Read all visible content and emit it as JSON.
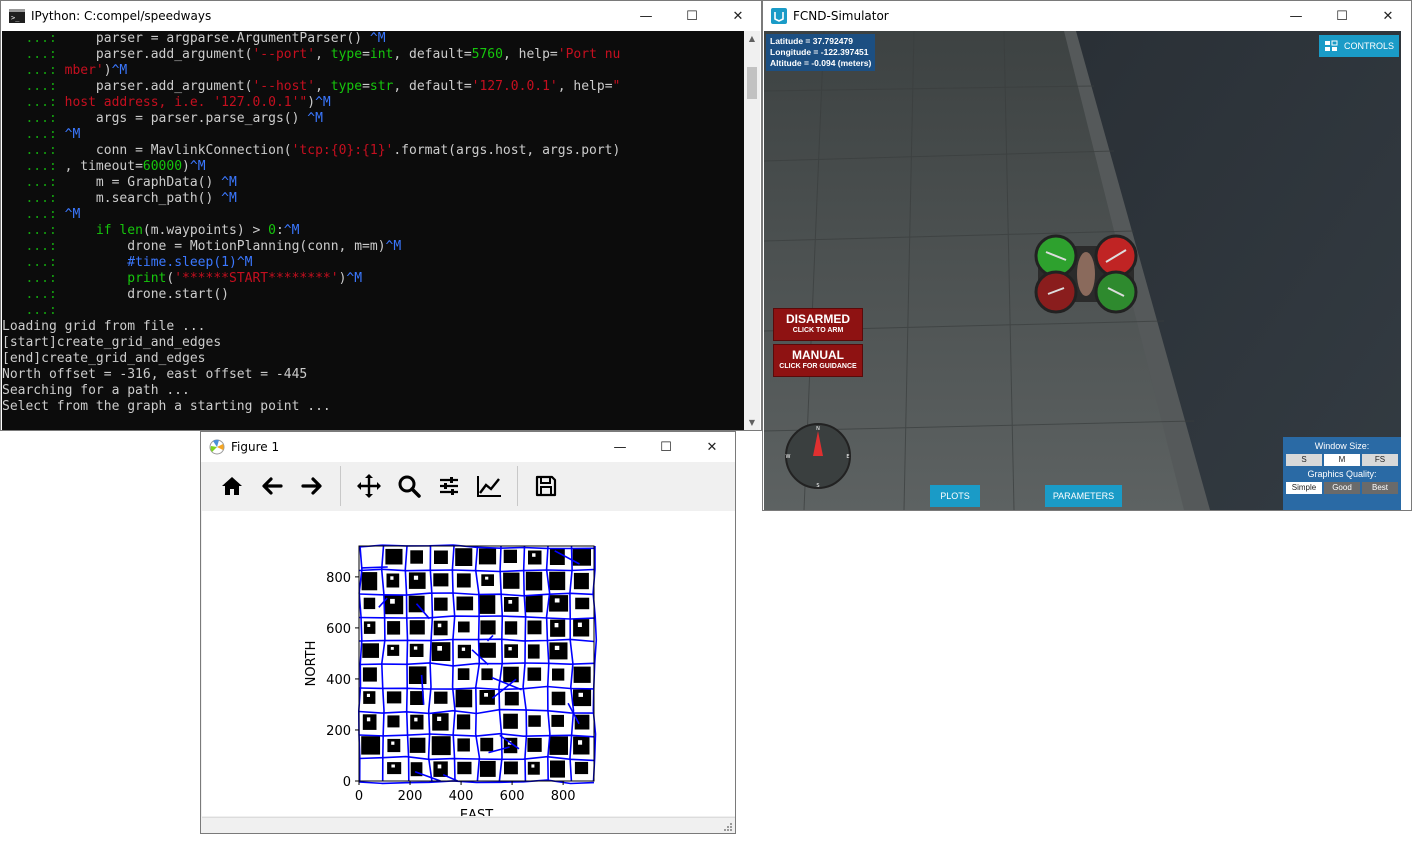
{
  "ipython": {
    "title": "IPython: C:compel/speedways",
    "lines": [
      [
        [
          "prm",
          "   ...: "
        ],
        [
          "cw",
          "    parser = argparse.ArgumentParser() "
        ],
        [
          "cb",
          "^M"
        ]
      ],
      [
        [
          "prm",
          "   ...: "
        ],
        [
          "cw",
          "    parser.add_argument("
        ],
        [
          "cr",
          "'--port'"
        ],
        [
          "cw",
          ", "
        ],
        [
          "cg",
          "type"
        ],
        [
          "cw",
          "="
        ],
        [
          "cg",
          "int"
        ],
        [
          "cw",
          ", default="
        ],
        [
          "cg",
          "5760"
        ],
        [
          "cw",
          ", help="
        ],
        [
          "cr",
          "'Port nu"
        ]
      ],
      [
        [
          "prm",
          "   ...: "
        ],
        [
          "cr",
          "mber'"
        ],
        [
          "cw",
          ")"
        ],
        [
          "cb",
          "^M"
        ]
      ],
      [
        [
          "prm",
          "   ...: "
        ],
        [
          "cw",
          "    parser.add_argument("
        ],
        [
          "cr",
          "'--host'"
        ],
        [
          "cw",
          ", "
        ],
        [
          "cg",
          "type"
        ],
        [
          "cw",
          "="
        ],
        [
          "cg",
          "str"
        ],
        [
          "cw",
          ", default="
        ],
        [
          "cr",
          "'127.0.0.1'"
        ],
        [
          "cw",
          ", help="
        ],
        [
          "cr",
          "\""
        ]
      ],
      [
        [
          "prm",
          "   ...: "
        ],
        [
          "cr",
          "host address, i.e. '127.0.0.1'\""
        ],
        [
          "cw",
          ")"
        ],
        [
          "cb",
          "^M"
        ]
      ],
      [
        [
          "prm",
          "   ...: "
        ],
        [
          "cw",
          "    args = parser.parse_args() "
        ],
        [
          "cb",
          "^M"
        ]
      ],
      [
        [
          "prm",
          "   ...: "
        ],
        [
          "cb",
          "^M"
        ]
      ],
      [
        [
          "prm",
          "   ...: "
        ],
        [
          "cw",
          "    conn = MavlinkConnection("
        ],
        [
          "cr",
          "'tcp:{0}:{1}'"
        ],
        [
          "cw",
          ".format(args.host, args.port)"
        ]
      ],
      [
        [
          "prm",
          "   ...: "
        ],
        [
          "cw",
          ", timeout="
        ],
        [
          "cg",
          "60000"
        ],
        [
          "cw",
          ")"
        ],
        [
          "cb",
          "^M"
        ]
      ],
      [
        [
          "prm",
          "   ...: "
        ],
        [
          "cw",
          "    m = GraphData() "
        ],
        [
          "cb",
          "^M"
        ]
      ],
      [
        [
          "prm",
          "   ...: "
        ],
        [
          "cw",
          "    m.search_path() "
        ],
        [
          "cb",
          "^M"
        ]
      ],
      [
        [
          "prm",
          "   ...: "
        ],
        [
          "cb",
          "^M"
        ]
      ],
      [
        [
          "prm",
          "   ...: "
        ],
        [
          "cw",
          "    "
        ],
        [
          "cg",
          "if"
        ],
        [
          "cw",
          " "
        ],
        [
          "cg",
          "len"
        ],
        [
          "cw",
          "(m.waypoints) > "
        ],
        [
          "cg",
          "0"
        ],
        [
          "cw",
          ":"
        ],
        [
          "cb",
          "^M"
        ]
      ],
      [
        [
          "prm",
          "   ...: "
        ],
        [
          "cw",
          "        drone = MotionPlanning(conn, m=m)"
        ],
        [
          "cb",
          "^M"
        ]
      ],
      [
        [
          "prm",
          "   ...: "
        ],
        [
          "cb",
          "        #time.sleep(1)"
        ],
        [
          "cb",
          "^M"
        ]
      ],
      [
        [
          "prm",
          "   ...: "
        ],
        [
          "cg",
          "        print"
        ],
        [
          "cw",
          "("
        ],
        [
          "cr",
          "'******START********'"
        ],
        [
          "cw",
          ")"
        ],
        [
          "cb",
          "^M"
        ]
      ],
      [
        [
          "prm",
          "   ...: "
        ],
        [
          "cw",
          "        drone.start()"
        ]
      ],
      [
        [
          "prm",
          "   ...: "
        ]
      ],
      [
        [
          "cw",
          "Loading grid from file ..."
        ]
      ],
      [
        [
          "cw",
          "[start]create_grid_and_edges"
        ]
      ],
      [
        [
          "cw",
          "[end]create_grid_and_edges"
        ]
      ],
      [
        [
          "cw",
          "North offset = -316, east offset = -445"
        ]
      ],
      [
        [
          "cw",
          "Searching for a path ..."
        ]
      ],
      [
        [
          "cw",
          "Select from the graph a starting point ..."
        ]
      ]
    ]
  },
  "simulator": {
    "title": "FCND-Simulator",
    "latitude": "Latitude = 37.792479",
    "longitude": "Longitude = -122.397451",
    "altitude": "Altitude = -0.094 (meters)",
    "controls": "CONTROLS",
    "disarmed": "DISARMED",
    "click_to_arm": "CLICK TO ARM",
    "manual": "MANUAL",
    "click_for_guidance": "CLICK FOR GUIDANCE",
    "plots": "PLOTS",
    "parameters": "PARAMETERS",
    "window_size": "Window Size:",
    "size_options": [
      "S",
      "M",
      "FS"
    ],
    "size_selected": "M",
    "graphics_quality": "Graphics Quality:",
    "quality_options": [
      "Simple",
      "Good",
      "Best"
    ],
    "quality_selected": "Simple",
    "compass_n": "N",
    "compass_s": "S",
    "compass_e": "E",
    "compass_w": "W"
  },
  "figure": {
    "title": "Figure 1",
    "toolbar": [
      "home-icon",
      "back-arrow-icon",
      "forward-arrow-icon",
      "pan-icon",
      "zoom-icon",
      "configure-subplots-icon",
      "edit-axis-icon",
      "save-icon"
    ]
  },
  "chart_data": {
    "type": "heatmap",
    "description_kind": "occupancy grid with graph edges",
    "xlabel": "EAST",
    "ylabel": "NORTH",
    "xlim": [
      0,
      921
    ],
    "ylim": [
      0,
      921
    ],
    "xticks": [
      0,
      200,
      400,
      600,
      800
    ],
    "yticks": [
      0,
      200,
      400,
      600,
      800
    ],
    "obstacle_color": "#000000",
    "free_color": "#ffffff",
    "edge_color": "#0000ff"
  },
  "colors": {
    "console_bg": "#0c0c0c",
    "sim_button": "#1a9bc7",
    "sim_red": "#8e1212",
    "sim_panel": "#2a6aa5"
  }
}
